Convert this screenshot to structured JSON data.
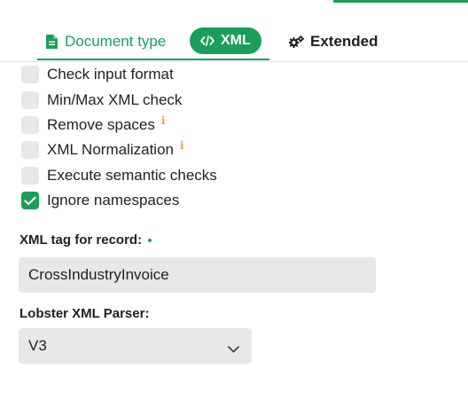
{
  "tabs": {
    "document_type": {
      "label": "Document type",
      "icon": "document-icon"
    },
    "xml": {
      "label": "XML",
      "icon": "code-icon",
      "active": true
    },
    "extended": {
      "label": "Extended",
      "icon": "gears-icon"
    }
  },
  "options": [
    {
      "label": "Check input format",
      "checked": false,
      "info": false
    },
    {
      "label": "Min/Max XML check",
      "checked": false,
      "info": false
    },
    {
      "label": "Remove spaces",
      "checked": false,
      "info": true
    },
    {
      "label": "XML Normalization",
      "checked": false,
      "info": true
    },
    {
      "label": "Execute semantic checks",
      "checked": false,
      "info": false
    },
    {
      "label": "Ignore namespaces",
      "checked": true,
      "info": false
    }
  ],
  "xml_tag": {
    "label": "XML tag for record:",
    "value": "CrossIndustryInvoice",
    "required": true
  },
  "parser": {
    "label": "Lobster XML Parser:",
    "value": "V3"
  },
  "colors": {
    "accent": "#1a9e5a",
    "info": "#e9a23b",
    "field_bg": "#e8e8e8"
  }
}
